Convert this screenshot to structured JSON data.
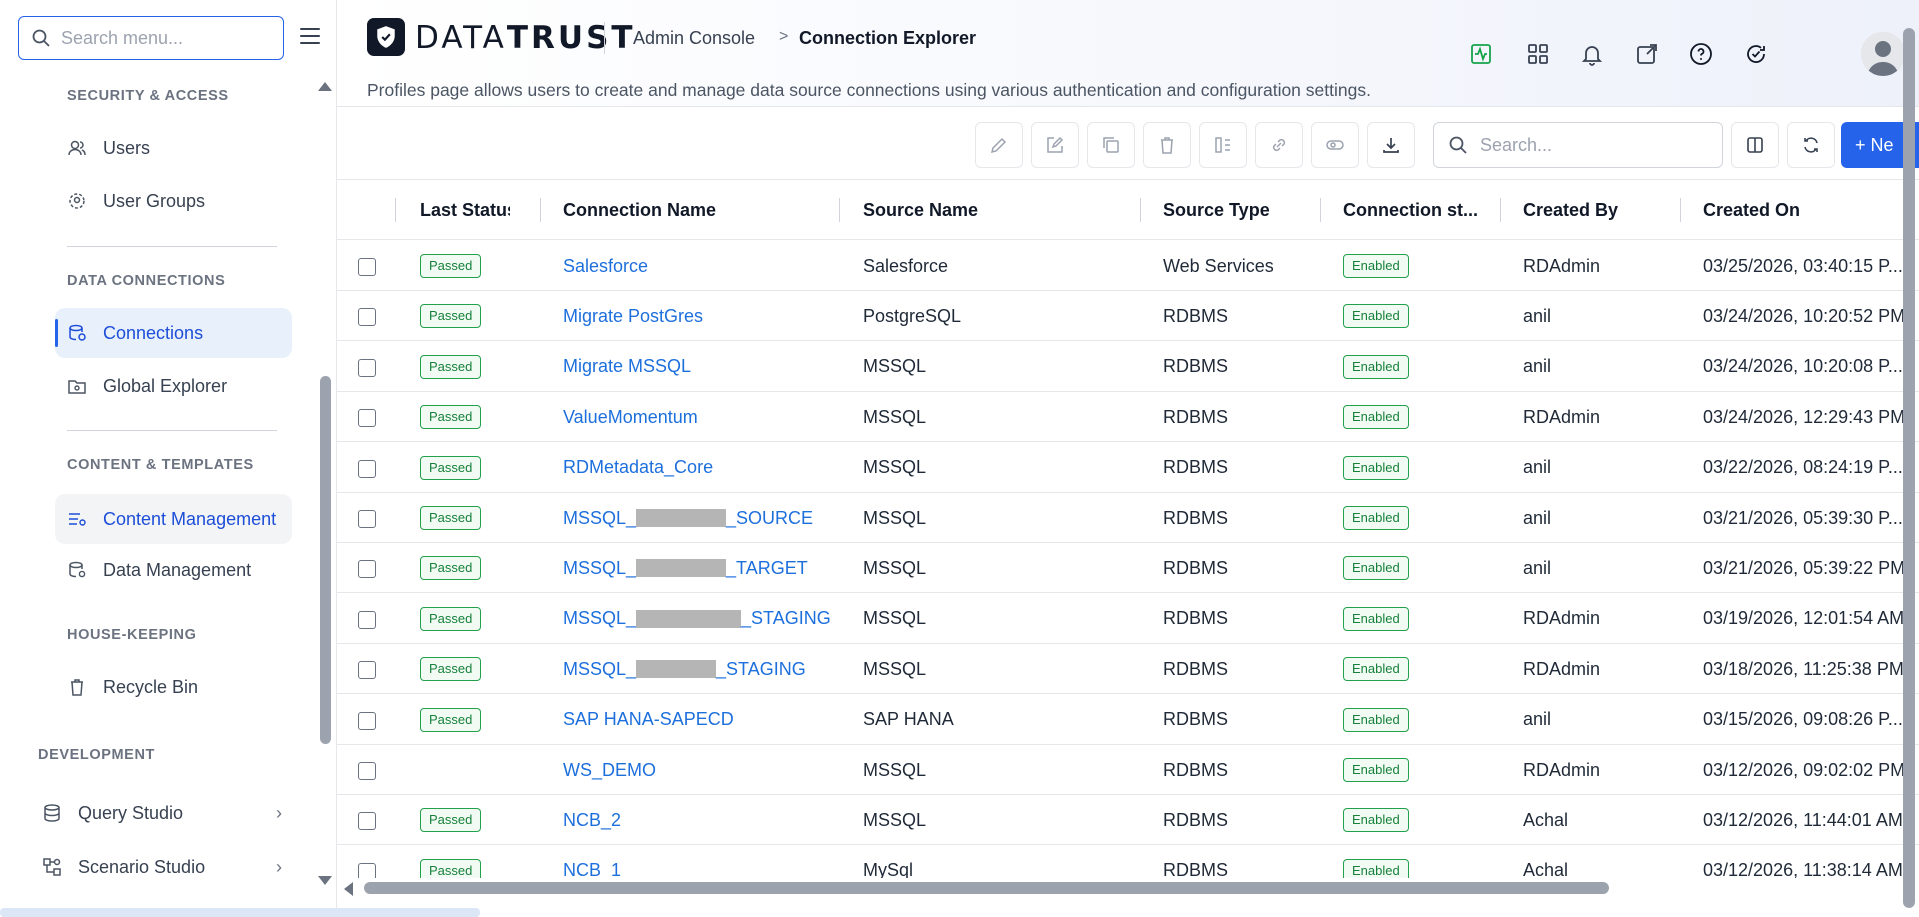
{
  "sidebar": {
    "search_placeholder": "Search menu...",
    "sections": {
      "security": "SECURITY & ACCESS",
      "data_connections": "DATA CONNECTIONS",
      "content": "CONTENT & TEMPLATES",
      "housekeeping": "HOUSE-KEEPING",
      "development": "DEVELOPMENT"
    },
    "items": {
      "users": "Users",
      "user_groups": "User Groups",
      "connections": "Connections",
      "global_explorer": "Global Explorer",
      "content_management": "Content Management",
      "data_management": "Data Management",
      "recycle_bin": "Recycle Bin",
      "query_studio": "Query Studio",
      "scenario_studio": "Scenario Studio"
    }
  },
  "header": {
    "logo_prefix": "DATA",
    "logo_suffix": "TRUST",
    "breadcrumb_parent": "Admin Console",
    "breadcrumb_separator": ">",
    "breadcrumb_current": "Connection Explorer",
    "subtitle": "Profiles page allows users to create and manage data source connections using various authentication and configuration settings.",
    "icons": [
      "activity-icon",
      "apps-grid-icon",
      "bell-icon",
      "external-link-icon",
      "help-icon",
      "refresh-check-icon"
    ]
  },
  "toolbar": {
    "search_placeholder": "Search...",
    "new_label": "+ Ne"
  },
  "table": {
    "columns": {
      "last_status": "Last Status",
      "connection_name": "Connection Name",
      "source_name": "Source Name",
      "source_type": "Source Type",
      "connection_status": "Connection st...",
      "created_by": "Created By",
      "created_on": "Created On"
    },
    "rows": [
      {
        "status": "Passed",
        "name": "Salesforce",
        "source": "Salesforce",
        "type": "Web Services",
        "conn": "Enabled",
        "by": "RDAdmin",
        "on": "03/25/2026, 03:40:15 P..."
      },
      {
        "status": "Passed",
        "name": "Migrate PostGres",
        "source": "PostgreSQL",
        "type": "RDBMS",
        "conn": "Enabled",
        "by": "anil",
        "on": "03/24/2026, 10:20:52 PM"
      },
      {
        "status": "Passed",
        "name": "Migrate MSSQL",
        "source": "MSSQL",
        "type": "RDBMS",
        "conn": "Enabled",
        "by": "anil",
        "on": "03/24/2026, 10:20:08 P..."
      },
      {
        "status": "Passed",
        "name": "ValueMomentum",
        "source": "MSSQL",
        "type": "RDBMS",
        "conn": "Enabled",
        "by": "RDAdmin",
        "on": "03/24/2026, 12:29:43 PM"
      },
      {
        "status": "Passed",
        "name": "RDMetadata_Core",
        "source": "MSSQL",
        "type": "RDBMS",
        "conn": "Enabled",
        "by": "anil",
        "on": "03/22/2026, 08:24:19 P..."
      },
      {
        "status": "Passed",
        "name_pre": "MSSQL_",
        "name_post": "_SOURCE",
        "source": "MSSQL",
        "type": "RDBMS",
        "conn": "Enabled",
        "by": "anil",
        "on": "03/21/2026, 05:39:30 P..."
      },
      {
        "status": "Passed",
        "name_pre": "MSSQL_",
        "name_post": "_TARGET",
        "source": "MSSQL",
        "type": "RDBMS",
        "conn": "Enabled",
        "by": "anil",
        "on": "03/21/2026, 05:39:22 PM"
      },
      {
        "status": "Passed",
        "name_pre": "MSSQL_",
        "name_post": "_STAGING",
        "source": "MSSQL",
        "type": "RDBMS",
        "conn": "Enabled",
        "by": "RDAdmin",
        "on": "03/19/2026, 12:01:54 AM"
      },
      {
        "status": "Passed",
        "name_pre": "MSSQL_",
        "name_post": "_STAGING",
        "source": "MSSQL",
        "type": "RDBMS",
        "conn": "Enabled",
        "by": "RDAdmin",
        "on": "03/18/2026, 11:25:38 PM"
      },
      {
        "status": "Passed",
        "name": "SAP HANA-SAPECD",
        "source": "SAP HANA",
        "type": "RDBMS",
        "conn": "Enabled",
        "by": "anil",
        "on": "03/15/2026, 09:08:26 P..."
      },
      {
        "status": "",
        "name": "WS_DEMO",
        "source": "MSSQL",
        "type": "RDBMS",
        "conn": "Enabled",
        "by": "RDAdmin",
        "on": "03/12/2026, 09:02:02 PM"
      },
      {
        "status": "Passed",
        "name": "NCB_2",
        "source": "MSSQL",
        "type": "RDBMS",
        "conn": "Enabled",
        "by": "Achal",
        "on": "03/12/2026, 11:44:01 AM"
      },
      {
        "status": "Passed",
        "name": "NCB_1",
        "source": "MySql",
        "type": "RDBMS",
        "conn": "Enabled",
        "by": "Achal",
        "on": "03/12/2026, 11:38:14 AM"
      }
    ]
  },
  "colors": {
    "accent": "#2563eb",
    "link": "#1d6fdc",
    "status_green": "#22a04b"
  }
}
